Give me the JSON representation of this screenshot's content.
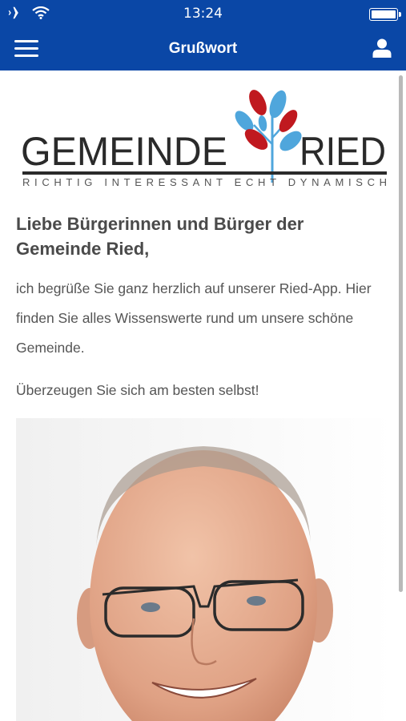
{
  "statusbar": {
    "time": "13:24"
  },
  "navbar": {
    "title": "Grußwort"
  },
  "logo": {
    "name_left": "GEMEINDE",
    "name_right": "RIED",
    "tagline": "RICHTIG INTERESSANT ECHT DYNAMISCH"
  },
  "content": {
    "heading": "Liebe Bürgerinnen und Bürger der Gemeinde Ried,",
    "paragraph1": "ich begrüße Sie ganz herzlich auf unserer Ried-App. Hier finden Sie alles Wissenswerte rund um unsere schöne Gemeinde.",
    "paragraph2": "Überzeugen Sie sich am besten selbst!"
  },
  "icons": {
    "airplane": "airplane-icon",
    "wifi": "wifi-icon",
    "battery": "battery-icon",
    "menu": "hamburger-menu-icon",
    "user": "user-icon"
  },
  "colors": {
    "header": "#0a47a6",
    "text": "#555555",
    "logo_red": "#c0191f",
    "logo_blue": "#4fa6dc"
  }
}
